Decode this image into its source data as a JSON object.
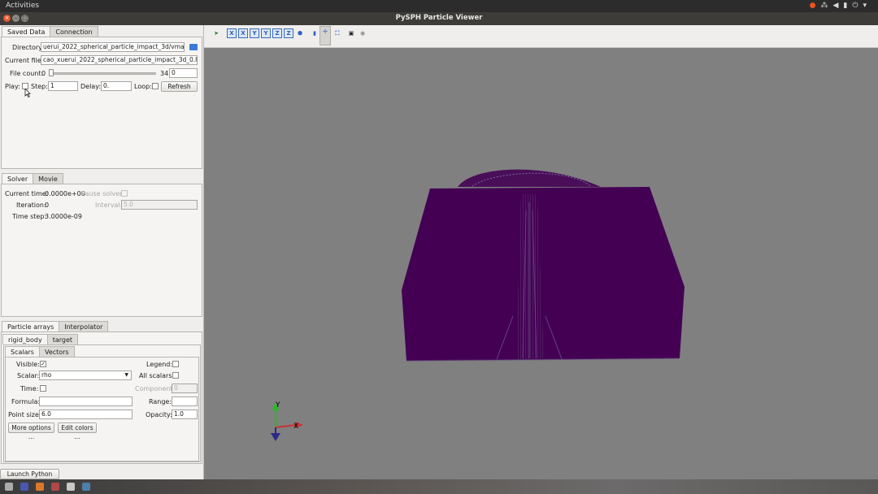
{
  "topbar": {
    "activities": "Activities"
  },
  "window": {
    "title": "PySPH Particle Viewer"
  },
  "data_tabs": {
    "saved_data": "Saved Data",
    "connection": "Connection"
  },
  "saved": {
    "directory_label": "Directory:",
    "directory_value": "uerui_2022_spherical_particle_impact_3d/vmag_12",
    "current_file_label": "Current file:",
    "current_file_value": "cao_xuerui_2022_spherical_particle_impact_3d_0.hdf5",
    "file_count_label": "File count:",
    "file_count_min": "0",
    "file_count_max": "34",
    "file_count_value": "0",
    "play_label": "Play:",
    "step_label": "Step:",
    "step_value": "1",
    "delay_label": "Delay:",
    "delay_value": "0.",
    "loop_label": "Loop:",
    "refresh_label": "Refresh"
  },
  "solver_tabs": {
    "solver": "Solver",
    "movie": "Movie"
  },
  "solver": {
    "current_time_label": "Current time:",
    "current_time_value": "0.0000e+00",
    "pause_label": "Pause solver:",
    "iteration_label": "Iteration:",
    "iteration_value": "0",
    "interval_label": "Interval:",
    "interval_value": "5.0",
    "time_step_label": "Time step:",
    "time_step_value": "3.0000e-09"
  },
  "particle_tabs": {
    "arrays": "Particle arrays",
    "interpolator": "Interpolator"
  },
  "array_tabs": {
    "rigid_body": "rigid_body",
    "target": "target"
  },
  "scalar_tabs": {
    "scalars": "Scalars",
    "vectors": "Vectors"
  },
  "scalars": {
    "visible_label": "Visible:",
    "visible_checked": "✓",
    "legend_label": "Legend:",
    "scalar_label": "Scalar:",
    "scalar_value": "rho",
    "all_scalars_label": "All scalars:",
    "time_label": "Time:",
    "component_label": "Component:",
    "component_value": "0",
    "formula_label": "Formula:",
    "formula_value": "",
    "range_label": "Range:",
    "range_value": "",
    "point_size_label": "Point size:",
    "point_size_value": "6.0",
    "opacity_label": "Opacity:",
    "opacity_value": "1.0",
    "more_options": "More options ...",
    "edit_colors": "Edit colors ..."
  },
  "bottom": {
    "launch_shell": "Launch Python Shell"
  },
  "axes": {
    "y": "Y",
    "x": "X"
  },
  "colors": {
    "particles": "#440154",
    "viewport_bg": "#808080",
    "axis_y": "#1fbf1f",
    "axis_x": "#c83232",
    "axis_z": "#2a2a8a"
  },
  "toolbar_icons": [
    "run-icon",
    "view-x-icon",
    "view-y-icon",
    "view-z-icon",
    "view-x-neg-icon",
    "view-y-neg-icon",
    "view-z-neg-icon",
    "iso-view-icon",
    "config-icon",
    "pick-icon",
    "fullscreen-icon",
    "save-icon",
    "record-icon"
  ]
}
